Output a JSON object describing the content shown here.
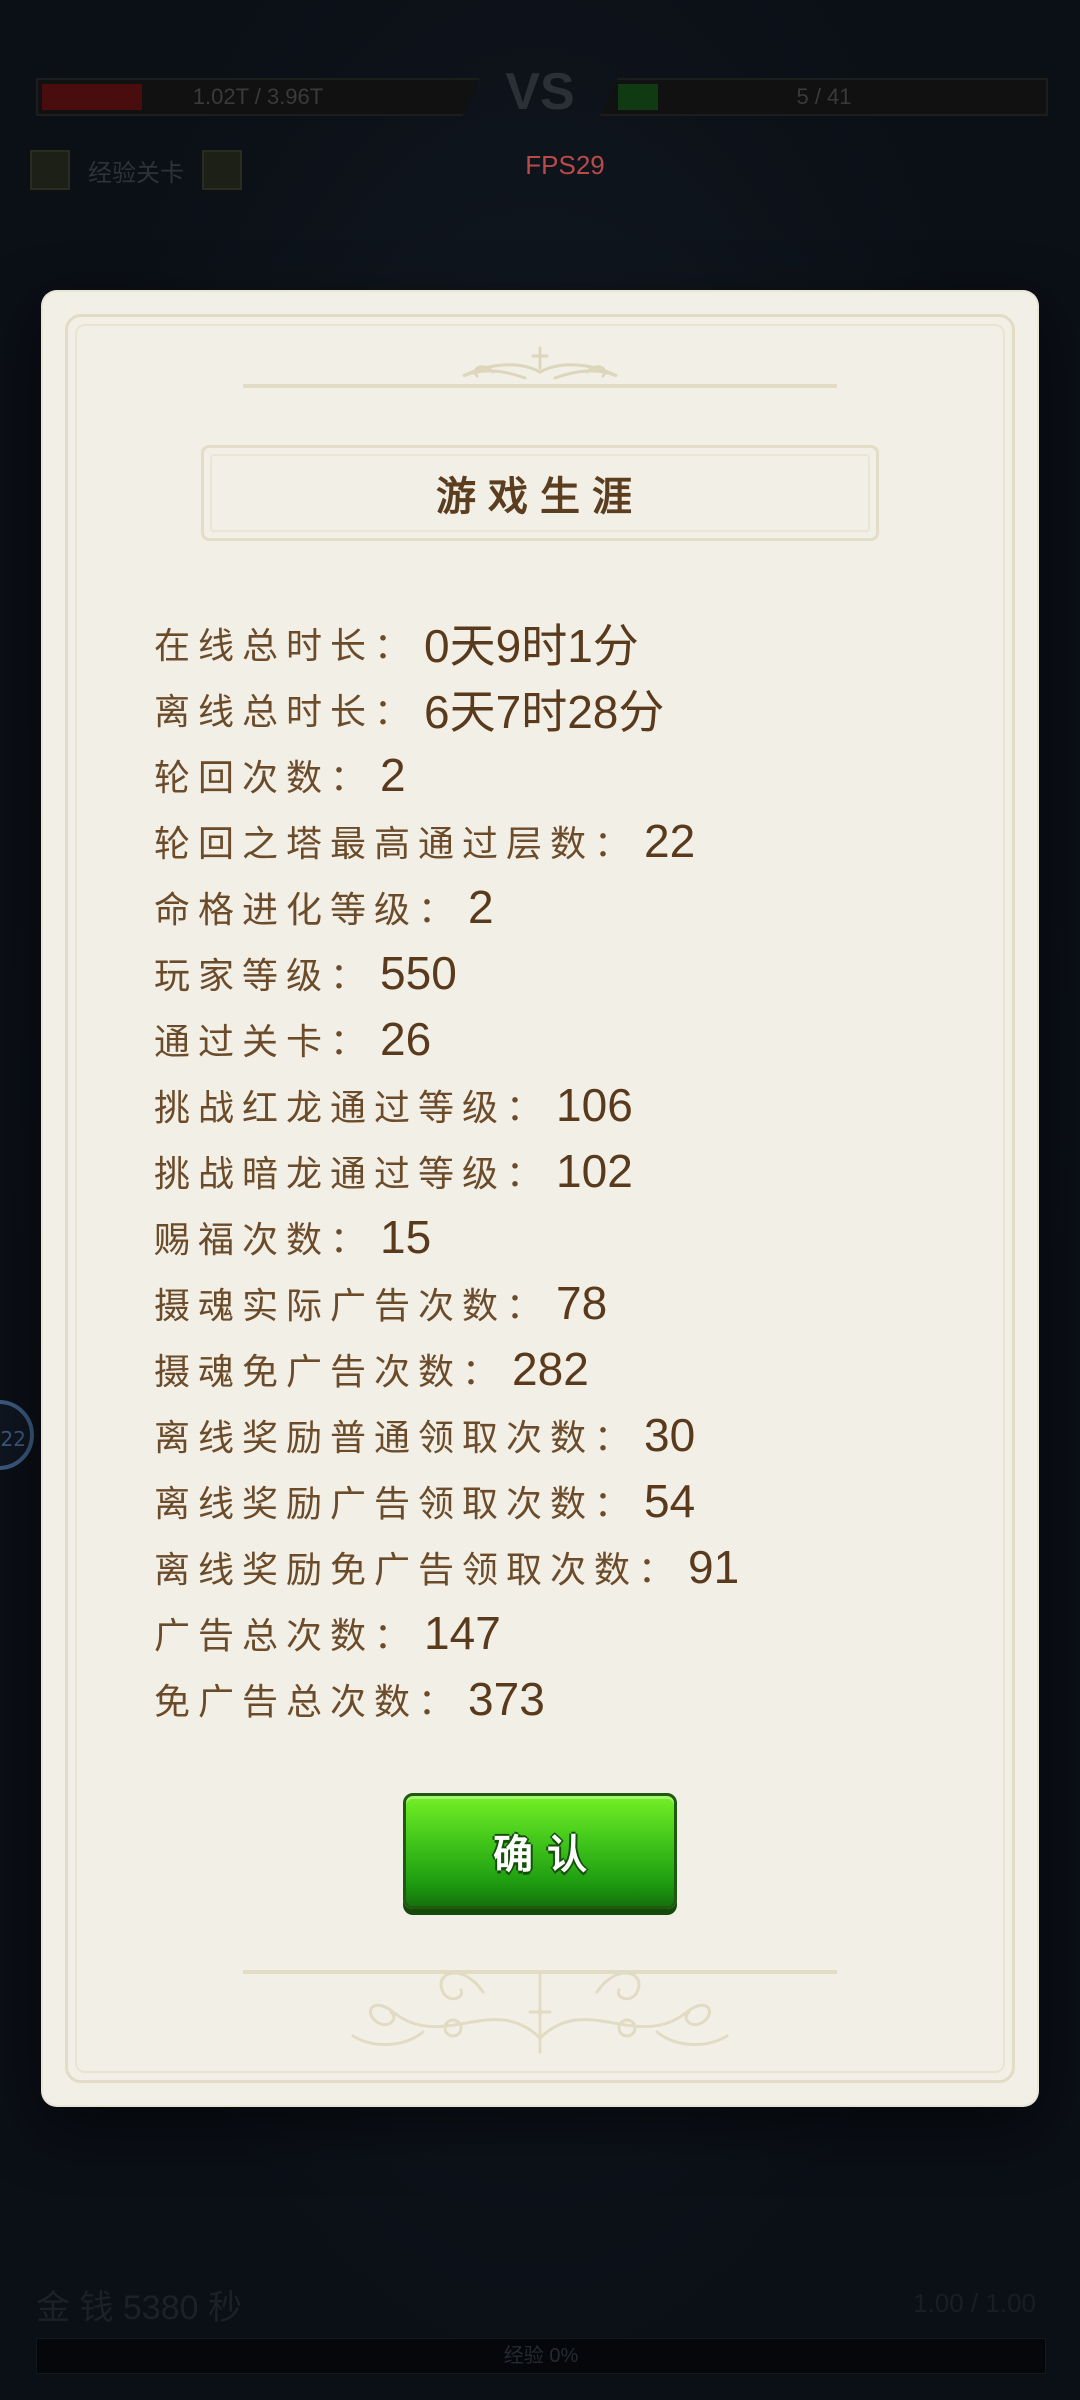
{
  "hud": {
    "left_hp_text": "1.02T / 3.96T",
    "vs_text": "VS",
    "right_hp_text": "5 / 41",
    "stage_label": "经验关卡",
    "fps_text": "FPS29",
    "side_bubble_text": "22",
    "bottom_left_text": "金 钱 5380 秒",
    "bottom_right_text": "1.00 / 1.00",
    "bottom_bar_text": "经验 0%"
  },
  "dialog": {
    "title": "游戏生涯",
    "stats": [
      {
        "label": "在线总时长",
        "value": "0天9时1分"
      },
      {
        "label": "离线总时长",
        "value": "6天7时28分"
      },
      {
        "label": "轮回次数",
        "value": "2"
      },
      {
        "label": "轮回之塔最高通过层数",
        "value": "22"
      },
      {
        "label": "命格进化等级",
        "value": "2"
      },
      {
        "label": "玩家等级",
        "value": "550"
      },
      {
        "label": "通过关卡",
        "value": "26"
      },
      {
        "label": "挑战红龙通过等级",
        "value": "106"
      },
      {
        "label": "挑战暗龙通过等级",
        "value": "102"
      },
      {
        "label": "赐福次数",
        "value": "15"
      },
      {
        "label": "摄魂实际广告次数",
        "value": "78"
      },
      {
        "label": "摄魂免广告次数",
        "value": "282"
      },
      {
        "label": "离线奖励普通领取次数",
        "value": "30"
      },
      {
        "label": "离线奖励广告领取次数",
        "value": "54"
      },
      {
        "label": "离线奖励免广告领取次数",
        "value": "91"
      },
      {
        "label": "广告总次数",
        "value": "147"
      },
      {
        "label": "免广告总次数",
        "value": "373"
      }
    ],
    "colon": "：",
    "confirm_label": "确认"
  }
}
